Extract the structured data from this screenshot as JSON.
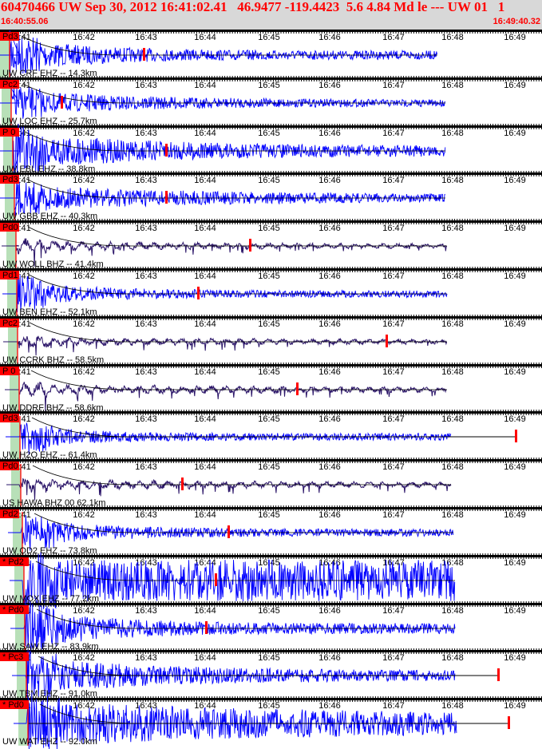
{
  "header": {
    "title": "60470466 UW Sep 30, 2012 16:41:02.41   46.9477 -119.4423  5.6 4.84 Md le --- UW 01   1",
    "start_time": "16:40:55.06",
    "end_time": "16:49:40.32"
  },
  "axis_ticks": [
    "16:41",
    "16:42",
    "16:43",
    "16:44",
    "16:45",
    "16:46",
    "16:47",
    "16:48",
    "16:49"
  ],
  "colors": {
    "title": "#ff0000",
    "trace_short_period": "#0000ff",
    "trace_broadband": "#2a1468",
    "pick": "#ff0000",
    "window": "#b8e0b8"
  },
  "traces": [
    {
      "label": "UW CRF EHZ -- 14.3km",
      "phase": "Pd3",
      "type": "EHZ"
    },
    {
      "label": "UW LOC EHZ -- 25.7km",
      "phase": "Pc2",
      "type": "EHZ"
    },
    {
      "label": "UW EBL EHZ -- 38.8km",
      "phase": "P 0",
      "type": "EHZ"
    },
    {
      "label": "UW GBB EHZ -- 40.3km",
      "phase": "Pd3",
      "type": "EHZ"
    },
    {
      "label": "UW WOLL BHZ -- 41.4km",
      "phase": "Pd0",
      "type": "BHZ"
    },
    {
      "label": "UW BEN EHZ -- 52.1km",
      "phase": "Pd1",
      "type": "EHZ"
    },
    {
      "label": "UW CCRK BHZ -- 58.5km",
      "phase": "Pc2",
      "type": "BHZ"
    },
    {
      "label": "UW DDRF BHZ -- 58.6km",
      "phase": "P 0",
      "type": "BHZ"
    },
    {
      "label": "UW H2O EHZ -- 61.4km",
      "phase": "Pd3",
      "type": "EHZ"
    },
    {
      "label": "US HAWA BHZ 00 62.1km",
      "phase": "Pd0",
      "type": "BHZ"
    },
    {
      "label": "UW OD2 EHZ -- 73.8km",
      "phase": "Pd2",
      "type": "EHZ"
    },
    {
      "label": "UW MOX EHZ -- 77.2km",
      "phase": "* Pd2",
      "type": "EHZ"
    },
    {
      "label": "UW SAW EHZ -- 83.9km",
      "phase": "* Pd0",
      "type": "EHZ"
    },
    {
      "label": "UW TBM EHZ -- 91.0km",
      "phase": "* Pc3",
      "type": "EHZ"
    },
    {
      "label": "UW WAT EHZ -- 92.0km",
      "phase": "* Pd0",
      "type": "EHZ"
    }
  ]
}
